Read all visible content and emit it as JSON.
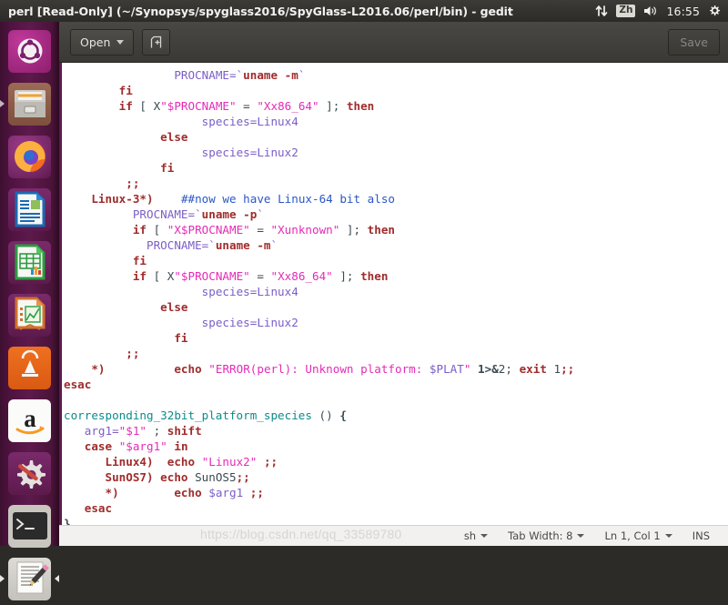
{
  "top_panel": {
    "window_title": "perl [Read-Only] (~/Synopsys/spyglass2016/SpyGlass-L2016.06/perl/bin) - gedit",
    "tray": {
      "network_icon": "network-up-down-icon",
      "input_method_label": "Zh",
      "volume_icon": "volume-icon",
      "clock": "16:55",
      "session_icon": "power-gear-icon"
    }
  },
  "launcher": {
    "items": [
      {
        "name": "ubuntu-dash",
        "label": "Ubuntu Dash",
        "running": false,
        "focused": false
      },
      {
        "name": "files",
        "label": "Files",
        "running": false,
        "focused": false
      },
      {
        "name": "firefox",
        "label": "Firefox Web Browser",
        "running": false,
        "focused": false
      },
      {
        "name": "libreoffice-writer",
        "label": "LibreOffice Writer",
        "running": false,
        "focused": false
      },
      {
        "name": "libreoffice-calc",
        "label": "LibreOffice Calc",
        "running": false,
        "focused": false
      },
      {
        "name": "libreoffice-impress",
        "label": "LibreOffice Impress",
        "running": false,
        "focused": false
      },
      {
        "name": "ubuntu-software",
        "label": "Ubuntu Software",
        "running": false,
        "focused": false
      },
      {
        "name": "amazon",
        "label": "Amazon",
        "running": false,
        "focused": false
      },
      {
        "name": "system-settings",
        "label": "System Settings",
        "running": false,
        "focused": false
      },
      {
        "name": "terminal",
        "label": "Terminal",
        "running": false,
        "focused": false
      },
      {
        "name": "gedit",
        "label": "gedit Text Editor",
        "running": true,
        "focused": true
      }
    ]
  },
  "toolbar": {
    "open_label": "Open",
    "new_tab_icon": "new-document-icon",
    "save_label": "Save",
    "save_enabled": false
  },
  "editor": {
    "language": "sh",
    "lines": [
      {
        "indent": 16,
        "tokens": [
          {
            "t": "PROCNAME=",
            "c": "var"
          },
          {
            "t": "`",
            "c": "tick"
          },
          {
            "t": "uname -m",
            "c": "cmd"
          },
          {
            "t": "`",
            "c": "tick"
          }
        ]
      },
      {
        "indent": 8,
        "tokens": [
          {
            "t": "fi",
            "c": "kw"
          }
        ]
      },
      {
        "indent": 8,
        "tokens": [
          {
            "t": "if",
            "c": "kw"
          },
          {
            "t": " [ X",
            "c": "plain"
          },
          {
            "t": "\"$PROCNAME\"",
            "c": "str"
          },
          {
            "t": " = ",
            "c": "plain"
          },
          {
            "t": "\"Xx86_64\"",
            "c": "str"
          },
          {
            "t": " ]; ",
            "c": "plain"
          },
          {
            "t": "then",
            "c": "kw"
          }
        ]
      },
      {
        "indent": 20,
        "tokens": [
          {
            "t": "species=Linux4",
            "c": "var"
          }
        ]
      },
      {
        "indent": 14,
        "tokens": [
          {
            "t": "else",
            "c": "kw"
          }
        ]
      },
      {
        "indent": 20,
        "tokens": [
          {
            "t": "species=Linux2",
            "c": "var"
          }
        ]
      },
      {
        "indent": 14,
        "tokens": [
          {
            "t": "fi",
            "c": "kw"
          }
        ]
      },
      {
        "indent": 9,
        "tokens": [
          {
            "t": ";;",
            "c": "kw"
          }
        ]
      },
      {
        "indent": 4,
        "tokens": [
          {
            "t": "Linux-3*)",
            "c": "pat"
          },
          {
            "t": "    ",
            "c": "plain"
          },
          {
            "t": "##now we have Linux-64 bit also",
            "c": "cmt"
          }
        ]
      },
      {
        "indent": 10,
        "tokens": [
          {
            "t": "PROCNAME=",
            "c": "var"
          },
          {
            "t": "`",
            "c": "tick"
          },
          {
            "t": "uname -p",
            "c": "cmd"
          },
          {
            "t": "`",
            "c": "tick"
          }
        ]
      },
      {
        "indent": 10,
        "tokens": [
          {
            "t": "if",
            "c": "kw"
          },
          {
            "t": " [ ",
            "c": "plain"
          },
          {
            "t": "\"X$PROCNAME\"",
            "c": "str"
          },
          {
            "t": " = ",
            "c": "plain"
          },
          {
            "t": "\"Xunknown\"",
            "c": "str"
          },
          {
            "t": " ]; ",
            "c": "plain"
          },
          {
            "t": "then",
            "c": "kw"
          }
        ]
      },
      {
        "indent": 12,
        "tokens": [
          {
            "t": "PROCNAME=",
            "c": "var"
          },
          {
            "t": "`",
            "c": "tick"
          },
          {
            "t": "uname -m",
            "c": "cmd"
          },
          {
            "t": "`",
            "c": "tick"
          }
        ]
      },
      {
        "indent": 10,
        "tokens": [
          {
            "t": "fi",
            "c": "kw"
          }
        ]
      },
      {
        "indent": 10,
        "tokens": [
          {
            "t": "if",
            "c": "kw"
          },
          {
            "t": " [ X",
            "c": "plain"
          },
          {
            "t": "\"$PROCNAME\"",
            "c": "str"
          },
          {
            "t": " = ",
            "c": "plain"
          },
          {
            "t": "\"Xx86_64\"",
            "c": "str"
          },
          {
            "t": " ]; ",
            "c": "plain"
          },
          {
            "t": "then",
            "c": "kw"
          }
        ]
      },
      {
        "indent": 20,
        "tokens": [
          {
            "t": "species=Linux4",
            "c": "var"
          }
        ]
      },
      {
        "indent": 14,
        "tokens": [
          {
            "t": "else",
            "c": "kw"
          }
        ]
      },
      {
        "indent": 20,
        "tokens": [
          {
            "t": "species=Linux2",
            "c": "var"
          }
        ]
      },
      {
        "indent": 16,
        "tokens": [
          {
            "t": "fi",
            "c": "kw"
          }
        ]
      },
      {
        "indent": 9,
        "tokens": [
          {
            "t": ";;",
            "c": "kw"
          }
        ]
      },
      {
        "indent": 4,
        "tokens": [
          {
            "t": "*)",
            "c": "pat"
          },
          {
            "t": "          ",
            "c": "plain"
          },
          {
            "t": "echo",
            "c": "kw"
          },
          {
            "t": " ",
            "c": "plain"
          },
          {
            "t": "\"ERROR(perl): Unknown platform: ",
            "c": "str"
          },
          {
            "t": "$PLAT",
            "c": "var"
          },
          {
            "t": "\"",
            "c": "str"
          },
          {
            "t": " ",
            "c": "plain"
          },
          {
            "t": "1",
            "c": "num"
          },
          {
            "t": ">&",
            "c": "num"
          },
          {
            "t": "2",
            "c": "plain"
          },
          {
            "t": "; ",
            "c": "plain"
          },
          {
            "t": "exit",
            "c": "kw"
          },
          {
            "t": " ",
            "c": "plain"
          },
          {
            "t": "1",
            "c": "plain"
          },
          {
            "t": ";;",
            "c": "kw"
          }
        ]
      },
      {
        "indent": 0,
        "tokens": [
          {
            "t": "esac",
            "c": "kw"
          }
        ]
      },
      {
        "indent": 0,
        "tokens": []
      },
      {
        "indent": 0,
        "tokens": [
          {
            "t": "corresponding_32bit_platform_species",
            "c": "fn"
          },
          {
            "t": " () ",
            "c": "plain"
          },
          {
            "t": "{",
            "c": "brace"
          }
        ]
      },
      {
        "indent": 3,
        "tokens": [
          {
            "t": "arg1=",
            "c": "var"
          },
          {
            "t": "\"$1\"",
            "c": "str"
          },
          {
            "t": " ; ",
            "c": "plain"
          },
          {
            "t": "shift",
            "c": "kw"
          }
        ]
      },
      {
        "indent": 3,
        "tokens": [
          {
            "t": "case",
            "c": "kw"
          },
          {
            "t": " ",
            "c": "plain"
          },
          {
            "t": "\"$arg1\"",
            "c": "str"
          },
          {
            "t": " ",
            "c": "plain"
          },
          {
            "t": "in",
            "c": "kw"
          }
        ]
      },
      {
        "indent": 6,
        "tokens": [
          {
            "t": "Linux4)",
            "c": "pat"
          },
          {
            "t": "  ",
            "c": "plain"
          },
          {
            "t": "echo",
            "c": "kw"
          },
          {
            "t": " ",
            "c": "plain"
          },
          {
            "t": "\"Linux2\"",
            "c": "str"
          },
          {
            "t": " ",
            "c": "plain"
          },
          {
            "t": ";;",
            "c": "kw"
          }
        ]
      },
      {
        "indent": 6,
        "tokens": [
          {
            "t": "SunOS7)",
            "c": "pat"
          },
          {
            "t": " ",
            "c": "plain"
          },
          {
            "t": "echo",
            "c": "kw"
          },
          {
            "t": " SunOS5",
            "c": "plain"
          },
          {
            "t": ";;",
            "c": "kw"
          }
        ]
      },
      {
        "indent": 6,
        "tokens": [
          {
            "t": "*)",
            "c": "pat"
          },
          {
            "t": "        ",
            "c": "plain"
          },
          {
            "t": "echo",
            "c": "kw"
          },
          {
            "t": " ",
            "c": "plain"
          },
          {
            "t": "$arg1",
            "c": "var"
          },
          {
            "t": " ",
            "c": "plain"
          },
          {
            "t": ";;",
            "c": "kw"
          }
        ]
      },
      {
        "indent": 3,
        "tokens": [
          {
            "t": "esac",
            "c": "kw"
          }
        ]
      },
      {
        "indent": 0,
        "tokens": [
          {
            "t": "}",
            "c": "brace"
          }
        ]
      }
    ]
  },
  "status_bar": {
    "language": "sh",
    "tab_width": "Tab Width: 8",
    "position": "Ln 1, Col 1",
    "insert_mode": "INS",
    "watermark": "https://blog.csdn.net/qq_33589780"
  },
  "colors": {
    "panel_bg": "#2c2b28",
    "launcher_bg": "#5d1a4c",
    "editor_bg": "#ffffff",
    "keyword": "#a02c2c",
    "string": "#e52bb7",
    "variable": "#7b5ec7",
    "comment": "#2a56c6",
    "function": "#0d8b8b"
  }
}
